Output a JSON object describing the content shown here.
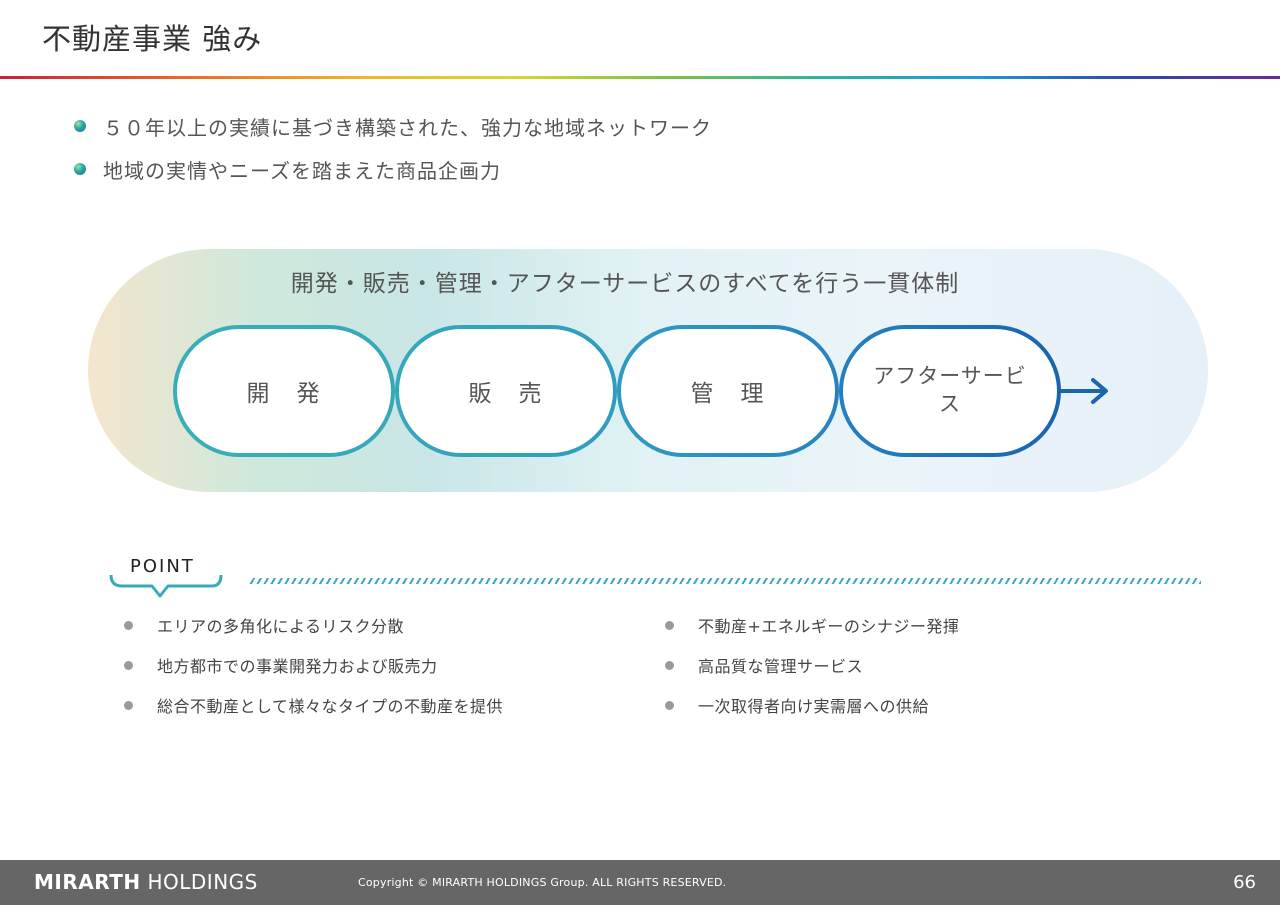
{
  "page": {
    "title": "不動産事業 強み"
  },
  "bullets": [
    "５０年以上の実績に基づき構築された、強力な地域ネットワーク",
    "地域の実情やニーズを踏まえた商品企画力"
  ],
  "flow": {
    "title": "開発・販売・管理・アフターサービスのすべてを行う一貫体制",
    "stages": [
      "開　発",
      "販　売",
      "管　理",
      "アフターサービス"
    ]
  },
  "point": {
    "label": "POINT",
    "left": [
      "エリアの多角化によるリスク分散",
      "地方都市での事業開発力および販売力",
      "総合不動産として様々なタイプの不動産を提供"
    ],
    "right": [
      "不動産+エネルギーのシナジー発揮",
      "高品質な管理サービス",
      "一次取得者向け実需層への供給"
    ]
  },
  "footer": {
    "logo_bold": "MIRARTH",
    "logo_rest": "HOLDINGS",
    "copyright": "Copyright © MIRARTH HOLDINGS Group. ALL RIGHTS RESERVED.",
    "page_number": "66"
  },
  "colors": {
    "accent_teal": "#3aa9b8",
    "accent_blue": "#1a64b0",
    "footer_bg": "#666666"
  }
}
